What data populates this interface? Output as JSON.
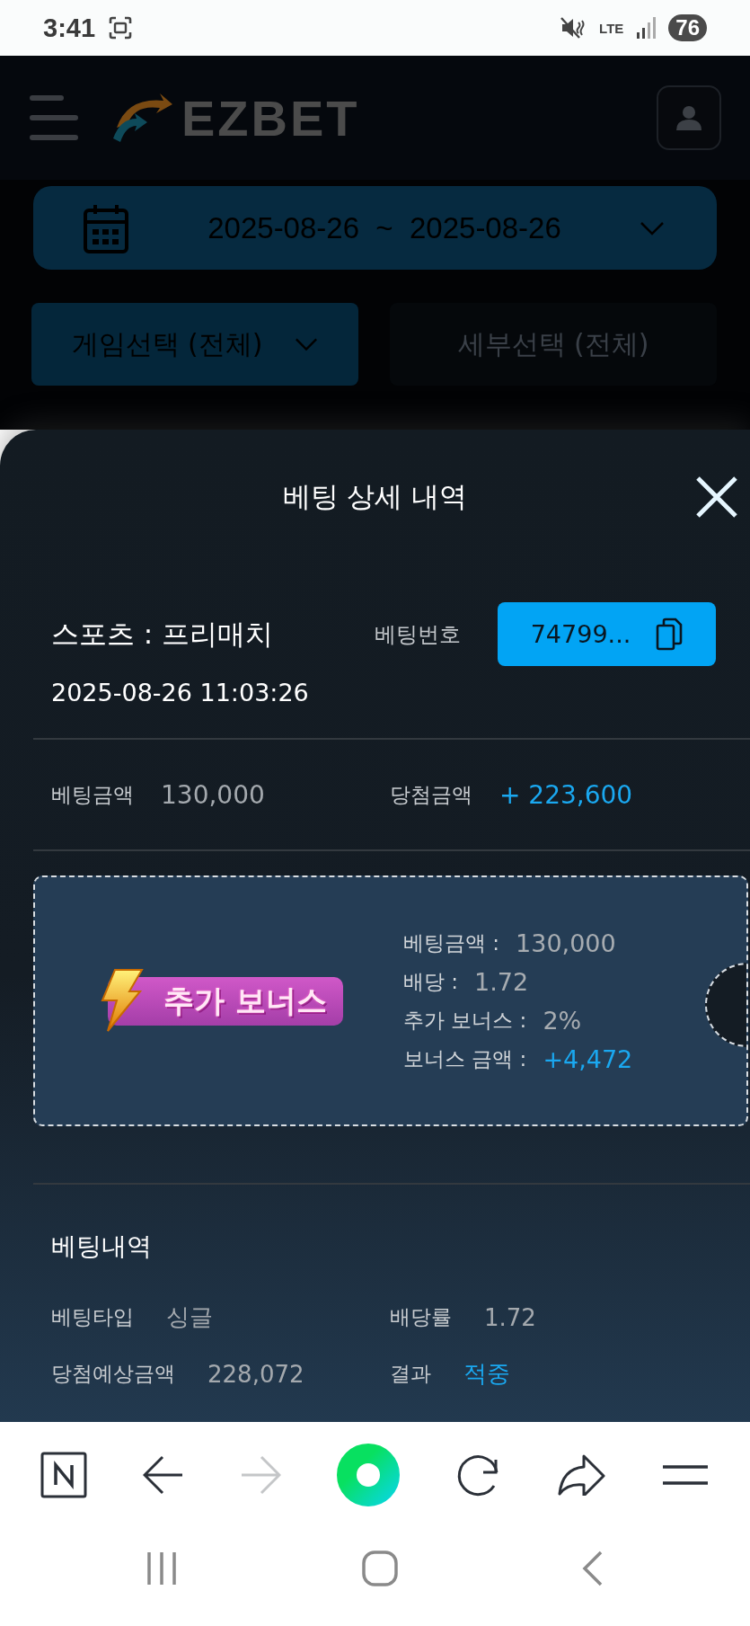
{
  "status_bar": {
    "time": "3:41",
    "network": "LTE",
    "battery": "76"
  },
  "header": {
    "logo": "EZBET"
  },
  "filters": {
    "date_from": "2025-08-26",
    "date_separator": "~",
    "date_to": "2025-08-26",
    "game_select": "게임선택 (전체)",
    "detail_select": "세부선택 (전체)"
  },
  "sheet": {
    "title": "베팅 상세 내역",
    "category": "스포츠 : 프리매치",
    "bet_number_label": "베팅번호",
    "bet_number": "74799...",
    "datetime": "2025-08-26 11:03:26",
    "summary": [
      {
        "label": "베팅금액",
        "value": "130,000",
        "highlight": false
      },
      {
        "label": "당첨금액",
        "value": "+ 223,600",
        "highlight": true
      }
    ],
    "bonus": {
      "badge": "추가 보너스",
      "rows": [
        {
          "label": "베팅금액 :",
          "value": "130,000",
          "highlight": false
        },
        {
          "label": "배당 :",
          "value": "1.72",
          "highlight": false
        },
        {
          "label": "추가 보너스 :",
          "value": "2%",
          "highlight": false
        },
        {
          "label": "보너스 금액 :",
          "value": "+4,472",
          "highlight": true
        }
      ]
    },
    "history": {
      "title": "베팅내역",
      "fields": [
        {
          "label": "베팅타입",
          "value": "싱글",
          "highlight": false
        },
        {
          "label": "배당률",
          "value": "1.72",
          "highlight": false
        },
        {
          "label": "당첨예상금액",
          "value": "228,072",
          "highlight": false
        },
        {
          "label": "결과",
          "value": "적중",
          "highlight": true
        }
      ]
    }
  },
  "browser_toolbar": {
    "forward_disabled": true
  }
}
